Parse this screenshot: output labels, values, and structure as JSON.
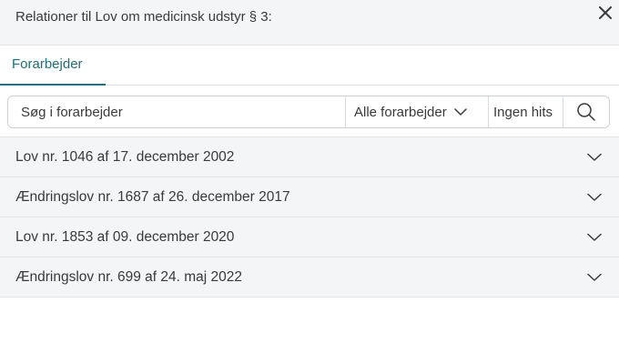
{
  "header": {
    "title": "Relationer til Lov om medicinsk udstyr § 3:",
    "close_icon": "close-icon"
  },
  "tabs": [
    {
      "label": "Forarbejder",
      "active": true
    }
  ],
  "search": {
    "placeholder": "Søg i forarbejder",
    "value": "",
    "filter_label": "Alle forarbejder",
    "hits_label": "Ingen hits",
    "search_icon": "search-icon"
  },
  "items": [
    {
      "label": "Lov nr. 1046 af 17. december 2002"
    },
    {
      "label": "Ændringslov nr. 1687 af 26. december 2017"
    },
    {
      "label": "Lov nr. 1853 af 09. december 2020"
    },
    {
      "label": "Ændringslov nr. 699 af 24. maj 2022"
    }
  ],
  "colors": {
    "accent": "#1f6f7a",
    "panel_bg": "#f4f5f6",
    "text": "#3a3a3a"
  }
}
